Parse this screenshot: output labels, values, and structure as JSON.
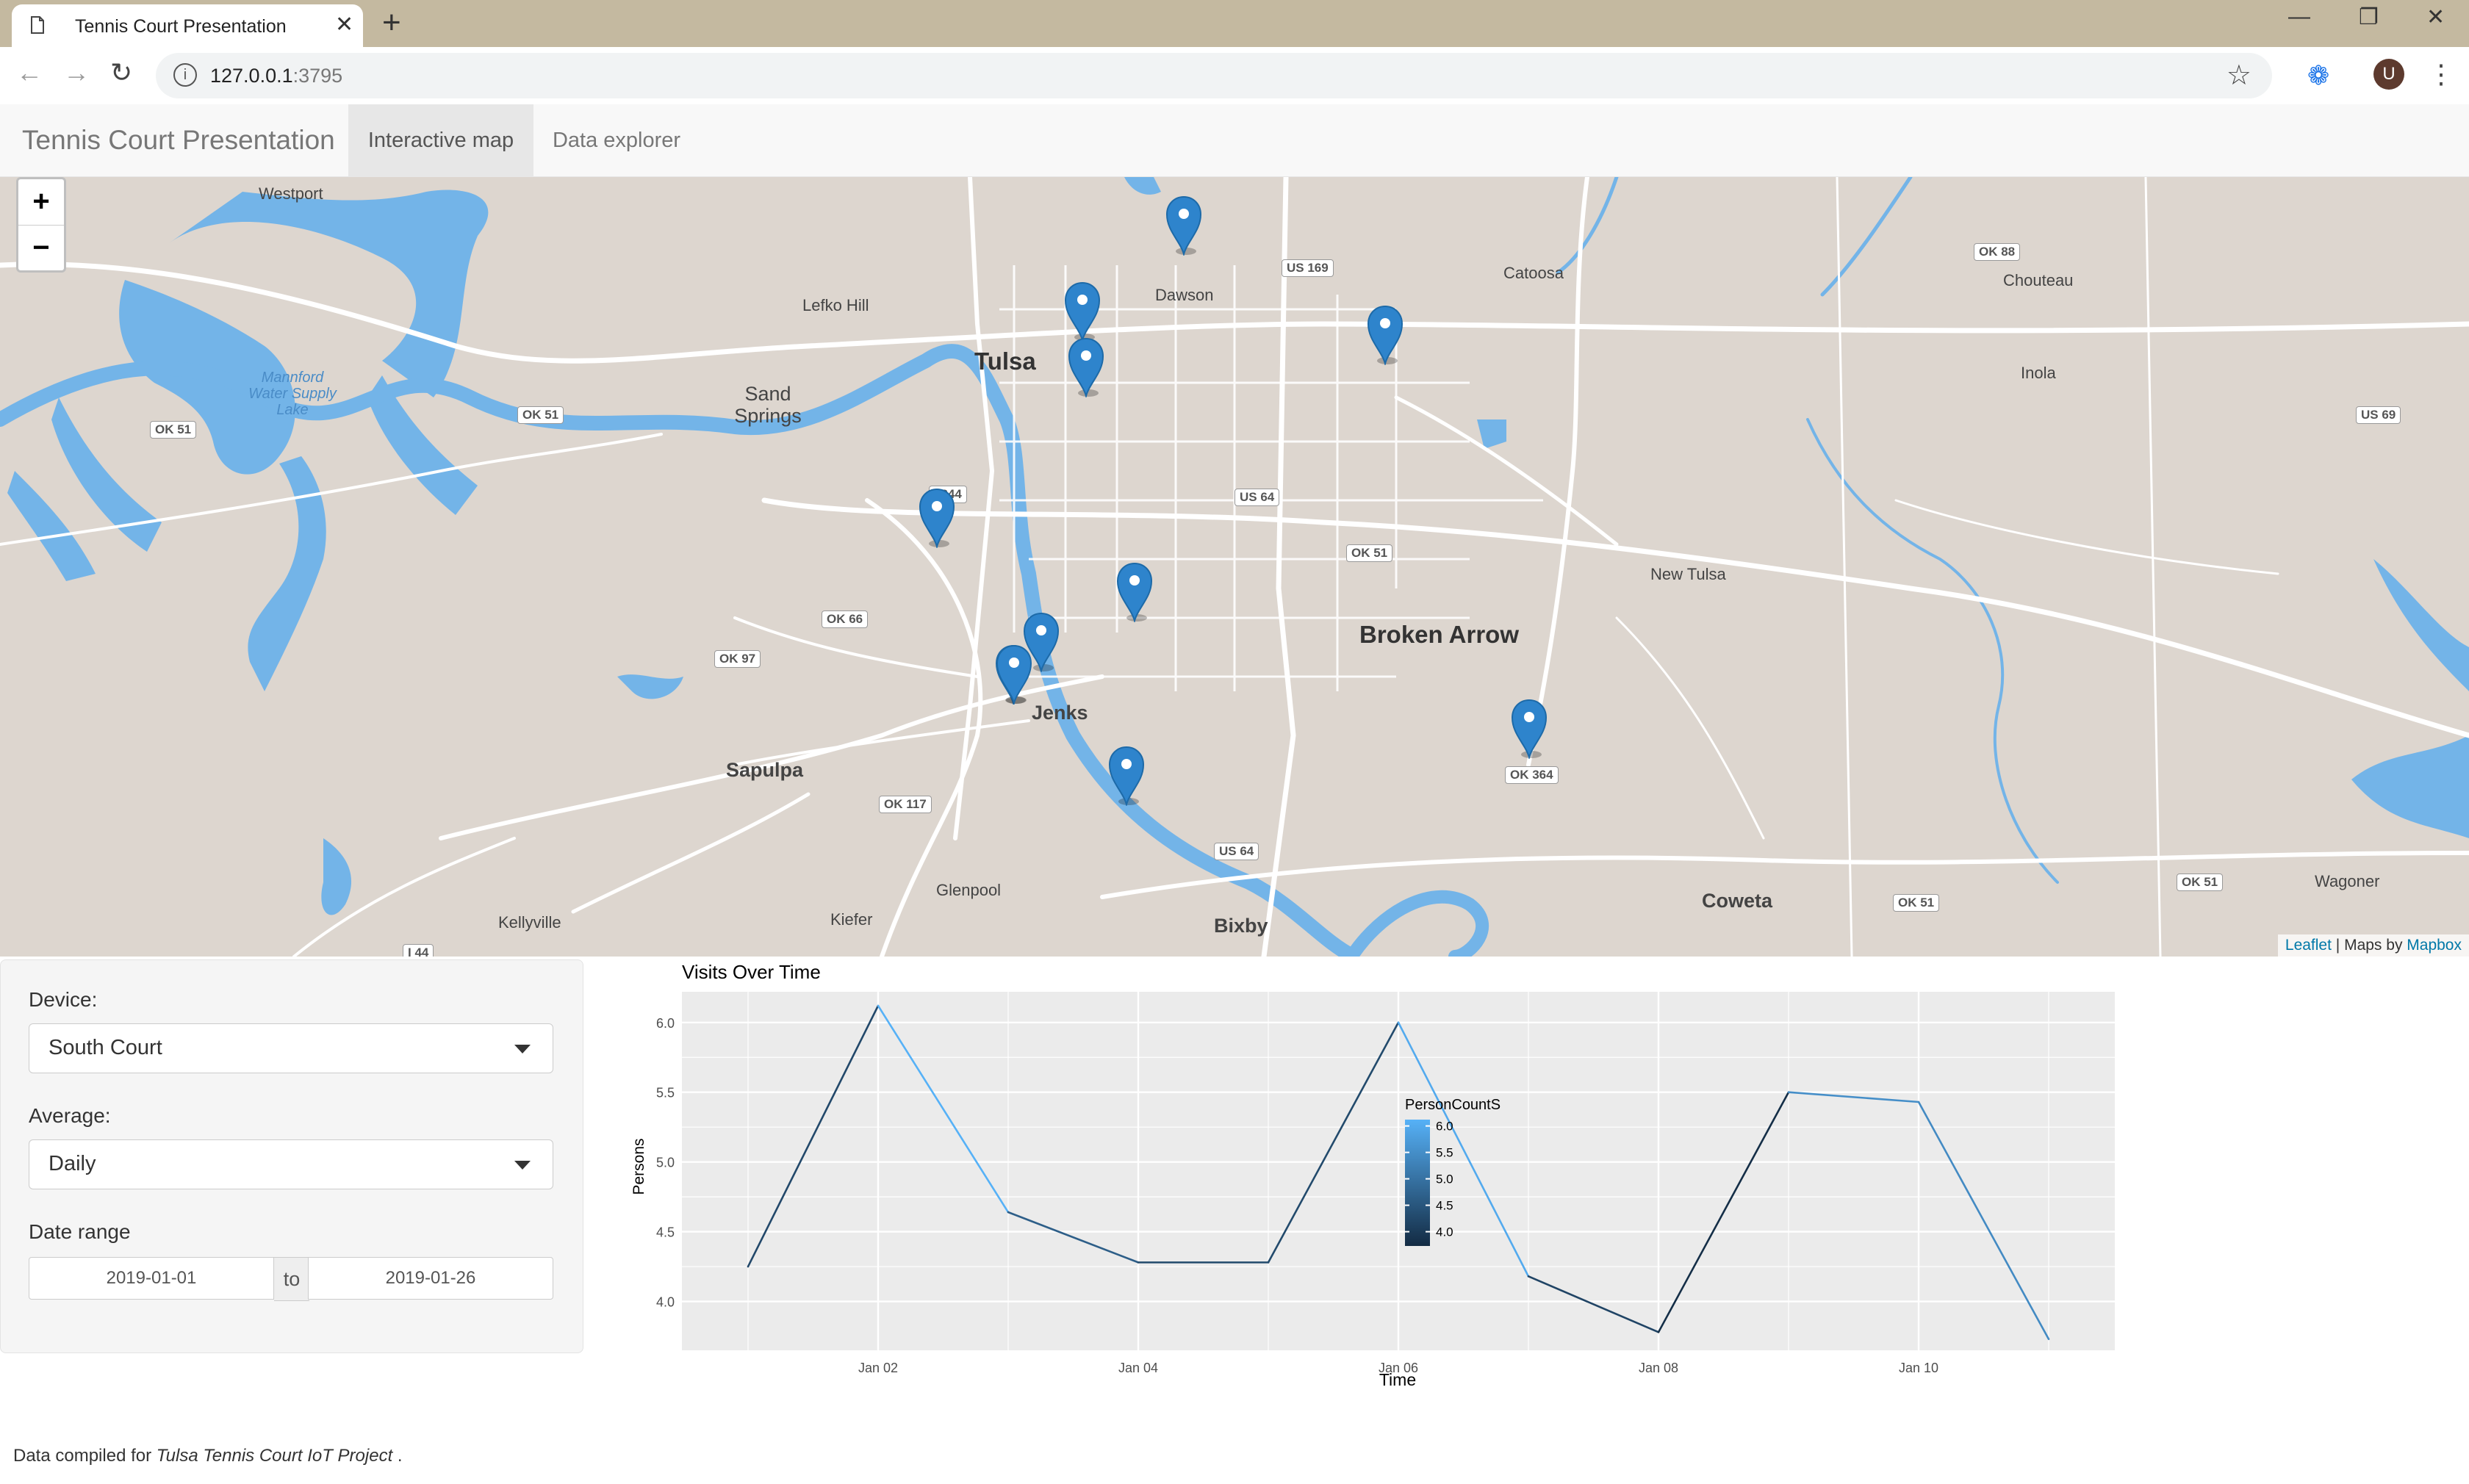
{
  "browser": {
    "tab_title": "Tennis Court Presentation",
    "url_host": "127.0.0.1",
    "url_port": ":3795",
    "avatar_letter": "U"
  },
  "navbar": {
    "brand": "Tennis Court Presentation",
    "tabs": [
      {
        "label": "Interactive map",
        "active": true
      },
      {
        "label": "Data explorer",
        "active": false
      }
    ]
  },
  "map": {
    "zoom_in": "+",
    "zoom_out": "−",
    "attribution": {
      "leaflet": "Leaflet",
      "sep": " | Maps by ",
      "mapbox": "Mapbox"
    },
    "places": {
      "westport": "Westport",
      "lefko_hill": "Lefko Hill",
      "tulsa": "Tulsa",
      "dawson": "Dawson",
      "catoosa": "Catoosa",
      "chouteau": "Chouteau",
      "inola": "Inola",
      "sand_springs": "Sand Springs",
      "mannford": "Mannford Water Supply Lake",
      "new_tulsa": "New Tulsa",
      "broken_arrow": "Broken Arrow",
      "jenks": "Jenks",
      "sapulpa": "Sapulpa",
      "glenpool": "Glenpool",
      "kiefer": "Kiefer",
      "bixby": "Bixby",
      "kellyville": "Kellyville",
      "coweta": "Coweta",
      "wagoner": "Wagoner"
    },
    "shields": {
      "us169": "US 169",
      "ok88": "OK 88",
      "ok51_w": "OK 51",
      "ok51_c": "OK 51",
      "ok51_mid": "OK 51",
      "us69": "US 69",
      "i244": "I 244",
      "us64_n": "US 64",
      "ok66": "OK 66",
      "ok97": "OK 97",
      "ok117": "OK 117",
      "us64_s": "US 64",
      "ok51_se": "OK 51",
      "ok51_e": "OK 51",
      "i44": "I 44",
      "ok364": "OK 364"
    },
    "marker_count": 11
  },
  "controls": {
    "device_label": "Device:",
    "device_value": "South Court",
    "average_label": "Average:",
    "average_value": "Daily",
    "date_label": "Date range",
    "date_start": "2019-01-01",
    "date_sep": "to",
    "date_end": "2019-01-26"
  },
  "chart_data": {
    "type": "line",
    "title": "Visits Over Time",
    "xlabel": "Time",
    "ylabel": "Persons",
    "x": [
      "2019-01-01",
      "2019-01-02",
      "2019-01-03",
      "2019-01-04",
      "2019-01-05",
      "2019-01-06",
      "2019-01-07",
      "2019-01-08",
      "2019-01-09",
      "2019-01-10",
      "2019-01-11"
    ],
    "values": [
      4.25,
      6.12,
      4.64,
      4.28,
      4.28,
      6.0,
      4.18,
      3.78,
      5.5,
      5.43,
      3.73
    ],
    "x_ticks": [
      "Jan 02",
      "Jan 04",
      "Jan 06",
      "Jan 08",
      "Jan 10"
    ],
    "y_ticks": [
      "4.0",
      "4.5",
      "5.0",
      "5.5",
      "6.0"
    ],
    "ylim": [
      3.65,
      6.22
    ],
    "grid": true,
    "legend": {
      "title": "PersonCountS",
      "labels": [
        "6.0",
        "5.5",
        "5.0",
        "4.5",
        "4.0"
      ],
      "low_color": "#132b43",
      "high_color": "#56b1f7",
      "placement": "right"
    }
  },
  "footer": {
    "prefix": "Data compiled for ",
    "project": "Tulsa Tennis Court IoT Project",
    "suffix": " ."
  }
}
